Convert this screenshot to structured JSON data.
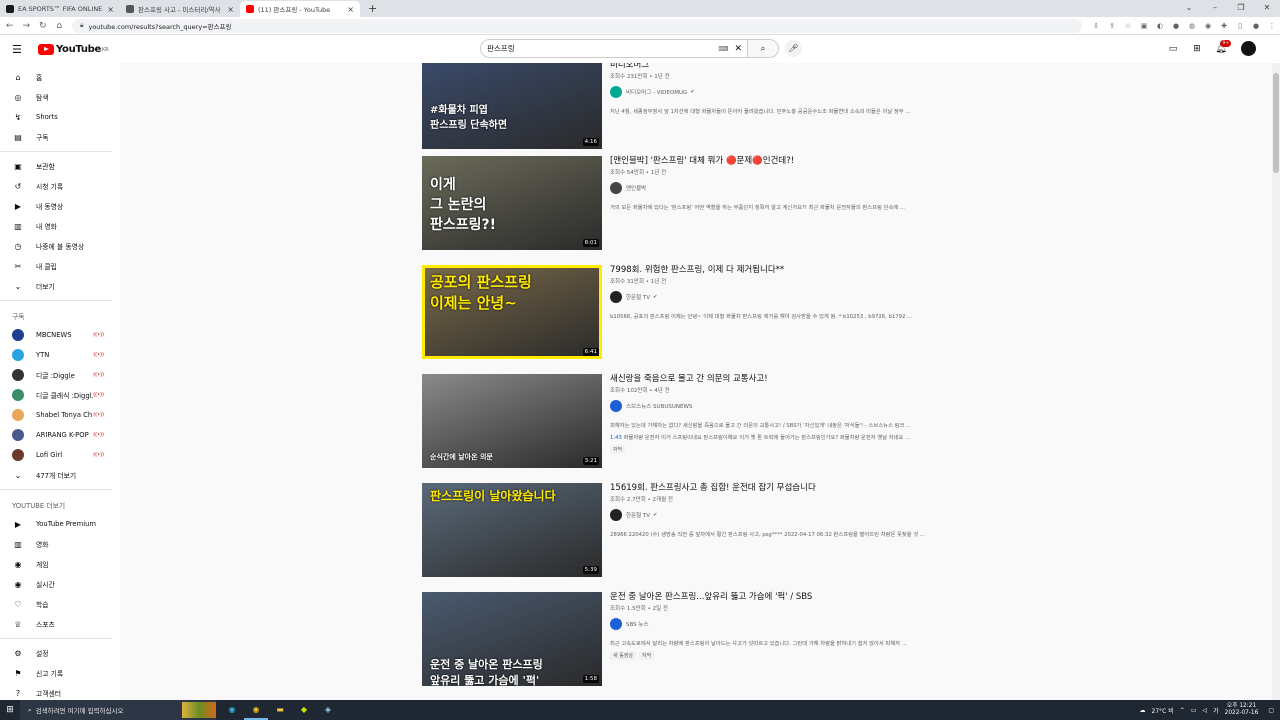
{
  "browser": {
    "tabs": [
      {
        "label": "EA SPORTS™ FIFA ONLINE 4",
        "color": "#1a1a1a"
      },
      {
        "label": "판스프링 사고 - 미스터리/역사",
        "color": "#555555"
      },
      {
        "label": "(11) 판스프링 - YouTube",
        "color": "#ff0000"
      }
    ],
    "url": "youtube.com/results?search_query=판스프링"
  },
  "header": {
    "logo": "YouTube",
    "logo_region": "KR",
    "search_value": "판스프링",
    "notification_count": "9+"
  },
  "sidebar": {
    "main": [
      {
        "icon": "⌂",
        "label": "홈"
      },
      {
        "icon": "◎",
        "label": "탐색"
      },
      {
        "icon": "↯",
        "label": "Shorts"
      },
      {
        "icon": "▤",
        "label": "구독"
      }
    ],
    "library": [
      {
        "icon": "▣",
        "label": "보관함"
      },
      {
        "icon": "↺",
        "label": "시청 기록"
      },
      {
        "icon": "▶",
        "label": "내 동영상"
      },
      {
        "icon": "▥",
        "label": "내 영화"
      },
      {
        "icon": "◷",
        "label": "나중에 볼 동영상"
      },
      {
        "icon": "✂",
        "label": "내 클립"
      },
      {
        "icon": "⌄",
        "label": "더보기"
      }
    ],
    "subs_heading": "구독",
    "subscriptions": [
      {
        "label": "MBCNEWS",
        "color": "#1c3f94"
      },
      {
        "label": "YTN",
        "color": "#29a3e0"
      },
      {
        "label": "디글 :Diggle",
        "color": "#333333"
      },
      {
        "label": "디글 클래식 :Diggl...",
        "color": "#3d8c6b"
      },
      {
        "label": "Shabel Tonya Ch",
        "color": "#e8a65a"
      },
      {
        "label": "ARIRANG K-POP",
        "color": "#4a5a8a"
      },
      {
        "label": "Lofi Girl",
        "color": "#6b3a2a"
      }
    ],
    "live_mark": "((•))",
    "more_subs": "477개 더보기",
    "more_heading": "YOUTUBE 더보기",
    "more": [
      {
        "icon": "▶",
        "label": "YouTube Premium"
      },
      {
        "icon": "▥",
        "label": "영화"
      },
      {
        "icon": "◉",
        "label": "게임"
      },
      {
        "icon": "◉",
        "label": "실시간"
      },
      {
        "icon": "♡",
        "label": "학습"
      },
      {
        "icon": "♕",
        "label": "스포츠"
      }
    ],
    "settings": [
      {
        "icon": "⚙",
        "label": "설정"
      },
      {
        "icon": "⚑",
        "label": "신고 기록"
      },
      {
        "icon": "?",
        "label": "고객센터"
      }
    ]
  },
  "results": [
    {
      "title": "비디오머그",
      "meta": "조회수 231만회 • 1년 전",
      "channel": "비디오머그 - VIDEOMUG",
      "verified": true,
      "desc": "지난 4월, 세종정부청사 앞 1차선에 대형 화물차들이 뜬이어 몰려왔습니다. 민주노총 공공운수노조 화물연대 소속의 미들은 이날 정부 ...",
      "duration": "4:16",
      "thumb_text": "#화물차 피엽\n판스프링 단속하면",
      "thumb_bg": "#3a4a6a",
      "chan_color": "#00a98f"
    },
    {
      "title": "[맨인블박] '판스프링' 대체 뭐가 🔴문제🔴인건데?!",
      "meta": "조회수 54만회 • 1년 전",
      "channel": "맨인블박",
      "verified": false,
      "desc": "거의 모든 화물차에 있다는 '판스프링' 어떤 역할을 하는 부품인지 정확히 알고 계신가요?! 최근 화물차 운전자들의 판스프링 단속에 ...",
      "duration": "8:01",
      "thumb_text": "이게\n그 논란의\n판스프링?!",
      "thumb_bg": "#6b6b5a",
      "chan_color": "#444444"
    },
    {
      "title": "7998회. 위험한 판스프링, 이제 다 제거됩니다**",
      "meta": "조회수 31만회 • 1년 전",
      "channel": "한문철 TV",
      "verified": true,
      "desc": "b10566, 공포의 판스프링 이제는 안녕~ 이제 대형 화물차 판스프링 제거를 해야 검사받을 수 있게 됨. * b10253 , b9726, b1792 ...",
      "duration": "6:41",
      "thumb_text": "공포의 판스프링\n이제는 안녕~",
      "thumb_bg": "#7a6a4a",
      "chan_color": "#222222"
    },
    {
      "title": "새신랑을 죽음으로 몰고 간 의문의 교통사고!",
      "meta": "조회수 102만회 • 4년 전",
      "channel": "스브스뉴스 SUBUSUNEWS",
      "verified": false,
      "desc": "피해자는 있는데 가해자는 없다? 새신랑을 죽음으로 몰고 간 의문의 교통사고! / SBS가 '자신있게' 내놓은 '자식들'! - 스브스뉴스 링크 ...",
      "chapter_time": "1:43",
      "chapter": "화물차량 운전자 이거 스프링이네요 판스프링이예요 이거 옛 톤 트럭에 들어가는 판스프링인가요? 화물차량 운전자 옛날 자네요 ...",
      "tags": [
        "자막"
      ],
      "duration": "3:21",
      "thumb_text": "순식간에 날아온 의문",
      "thumb_bg": "#8a8a8a",
      "chan_color": "#1c5fd6"
    },
    {
      "title": "15619회. 판스프링사고 총 집합! 운전대 잡기 무섭습니다",
      "meta": "조회수 2.7만회 • 2개월 전",
      "channel": "한문철 TV",
      "verified": true,
      "desc": "28966 220420 (수) 생방송 직전 중 앞차에서 튕긴 판스프링 사고, psg**** 2022-04-17 06:32 판스프링을 떨어뜨린 차량은 못찾을 것 ...",
      "duration": "5:39",
      "thumb_text": "판스프링이 날아왔습니다",
      "thumb_bg": "#5a6a7a",
      "chan_color": "#222222"
    },
    {
      "title": "운전 중 날아온 판스프링...앞유리 뚫고 가슴에 '퍽' / SBS",
      "meta": "조회수 1.5만회 • 2일 전",
      "channel": "SBS 뉴스",
      "verified": false,
      "desc": "최근 고속도로에서 달리는 차량에 판스프링이 날아드는 사고가 잇따르고 있습니다. 그런데 가해 차량을 밝혀내기 쉽지 않아서 피해자 ...",
      "tags": [
        "새 동영상",
        "자막"
      ],
      "duration": "1:58",
      "thumb_text": "운전 중 날아온 판스프링\n앞유리 뚫고 가슴에 '퍽'",
      "thumb_bg": "#4a5a70",
      "chan_color": "#1c5fd6"
    }
  ],
  "taskbar": {
    "search_placeholder": "검색하려면 여기에 입력하십시오",
    "weather": "27°C 비",
    "time": "오후 12:21",
    "date": "2022-07-16"
  }
}
